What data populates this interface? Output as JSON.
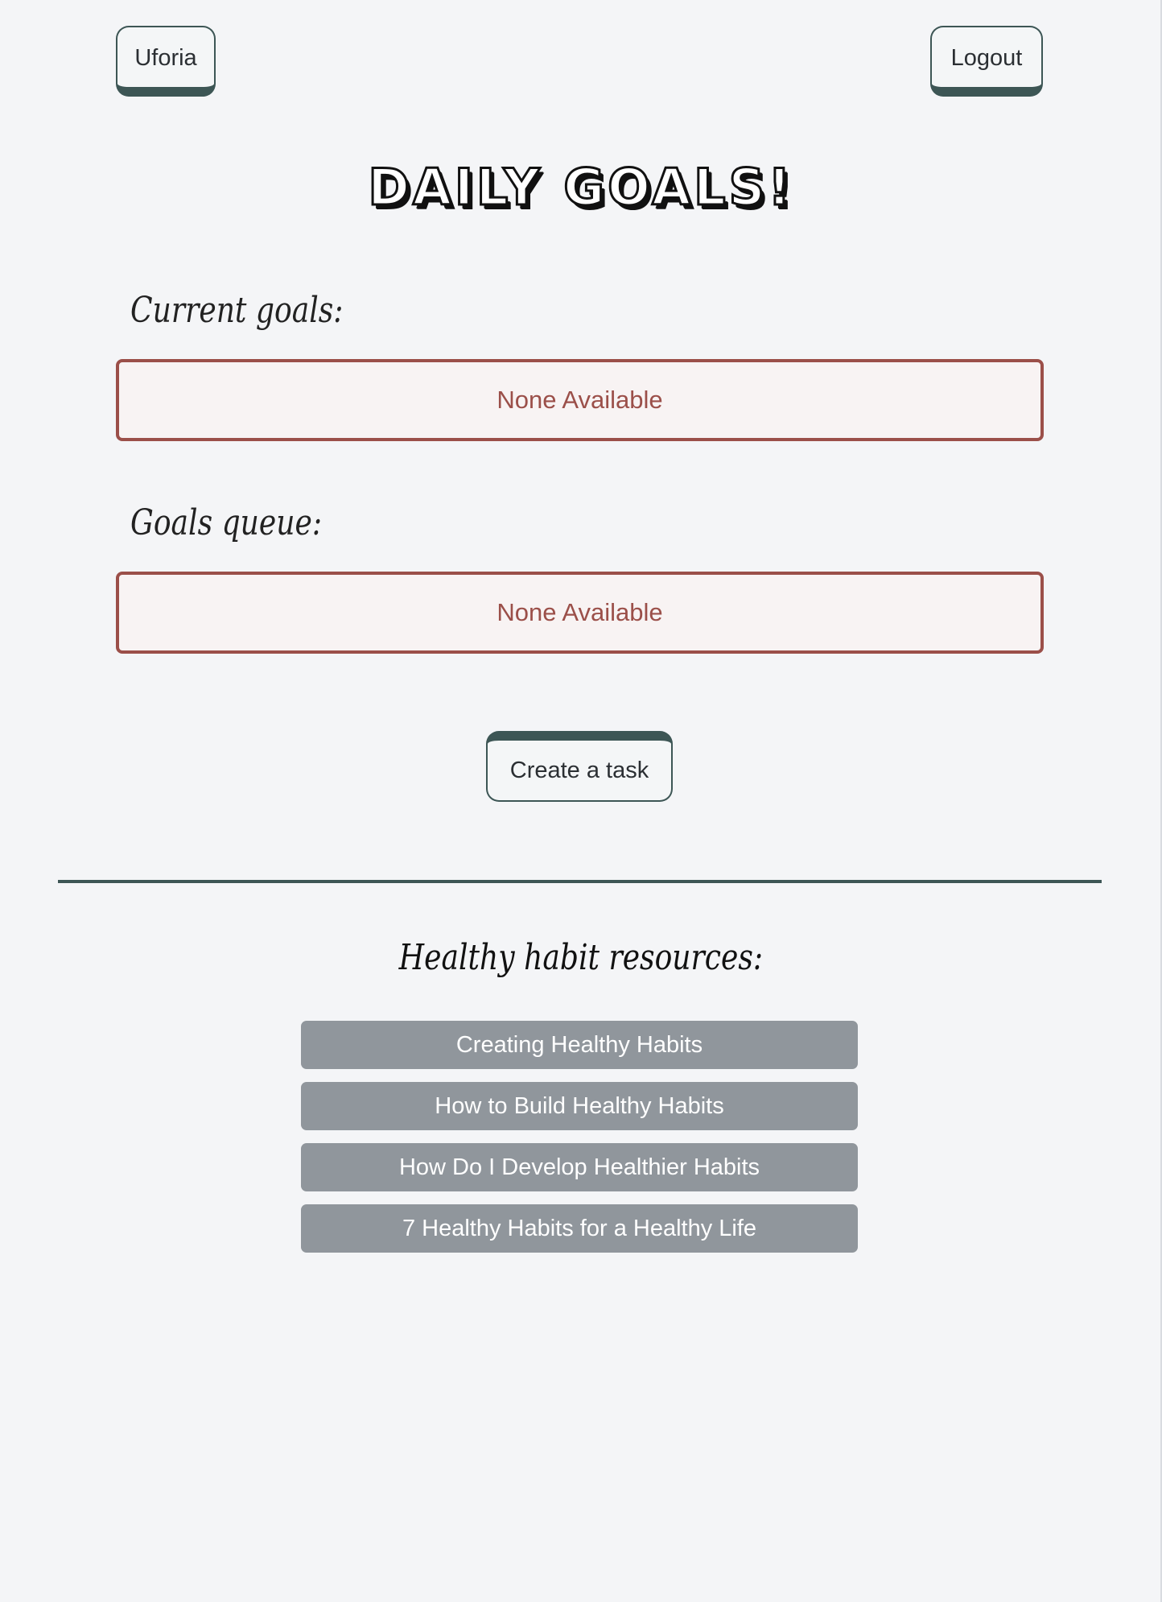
{
  "header": {
    "brand_label": "Uforia",
    "logout_label": "Logout"
  },
  "page_title": "DAILY GOALS!",
  "current_goals": {
    "label": "Current goals:",
    "empty_text": "None Available"
  },
  "goals_queue": {
    "label": "Goals queue:",
    "empty_text": "None Available"
  },
  "create_task_label": "Create a task",
  "resources": {
    "heading": "Healthy habit resources:",
    "links": [
      "Creating Healthy Habits",
      "How to Build Healthy Habits",
      "How Do I Develop Healthier Habits",
      "7 Healthy Habits for a Healthy Life"
    ]
  },
  "colors": {
    "background": "#f4f5f7",
    "accent": "#3d5655",
    "empty_border": "#9b4f49",
    "resource_button": "#90969c"
  }
}
